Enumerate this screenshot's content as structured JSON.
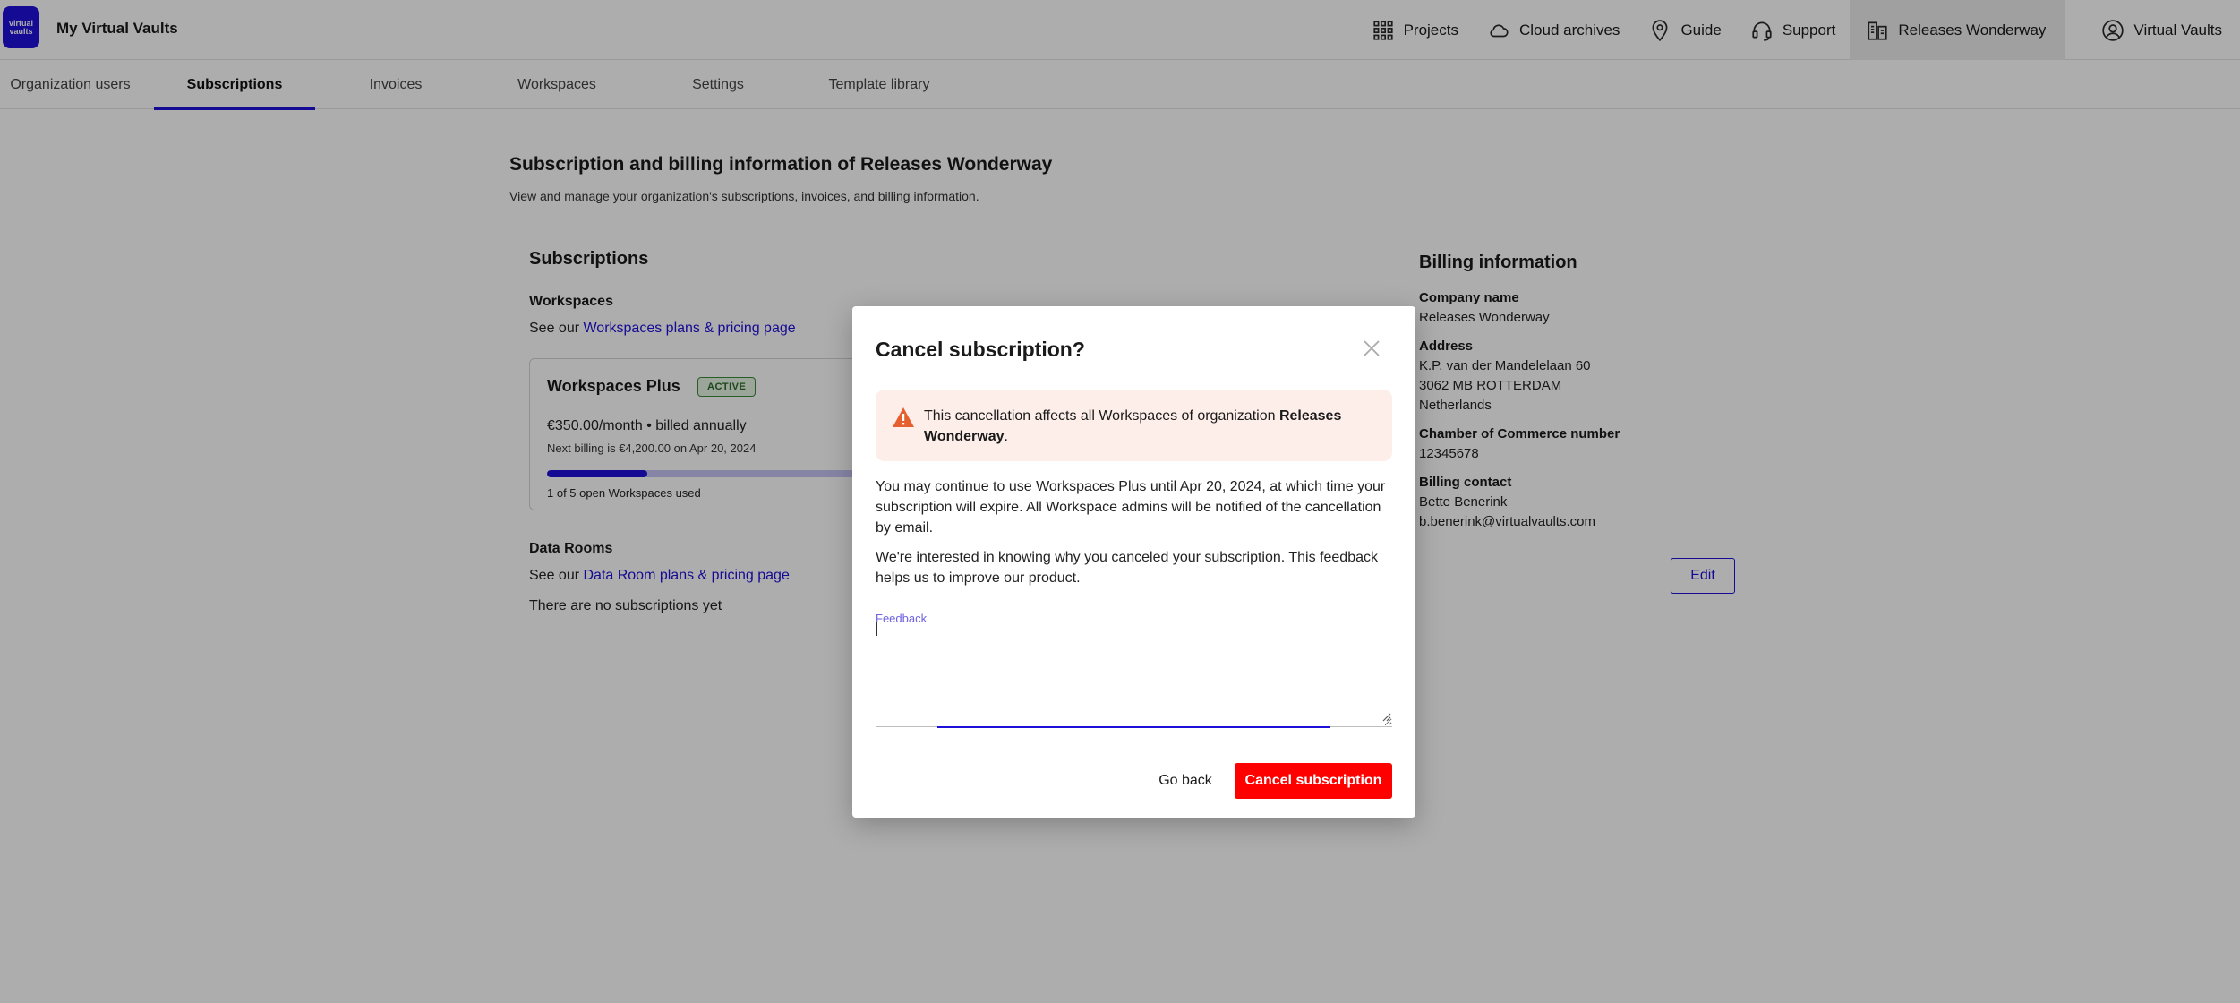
{
  "app": {
    "logo_line1": "virtual",
    "logo_line2": "vaults",
    "title": "My Virtual Vaults"
  },
  "topnav": {
    "projects": "Projects",
    "cloud_archives": "Cloud archives",
    "guide": "Guide",
    "support": "Support",
    "organization": "Releases Wonderway",
    "user": "Virtual Vaults"
  },
  "tabs": [
    {
      "label": "Organization users"
    },
    {
      "label": "Subscriptions",
      "active": true
    },
    {
      "label": "Invoices"
    },
    {
      "label": "Workspaces"
    },
    {
      "label": "Settings"
    },
    {
      "label": "Template library"
    }
  ],
  "page": {
    "title": "Subscription and billing information of Releases Wonderway",
    "subtitle": "View and manage your organization's subscriptions, invoices, and billing information."
  },
  "subscriptions": {
    "heading": "Subscriptions",
    "workspaces": {
      "title": "Workspaces",
      "see_prefix": "See our ",
      "link": "Workspaces plans & pricing page",
      "plan": {
        "name": "Workspaces Plus",
        "status": "ACTIVE",
        "price": "€350.00/month • billed annually",
        "next_billing": "Next billing is €4,200.00 on Apr 20, 2024",
        "usage_used": 1,
        "usage_total": 5,
        "usage_text": "1 of 5 open Workspaces used"
      }
    },
    "data_rooms": {
      "title": "Data Rooms",
      "see_prefix": "See our ",
      "link": "Data Room plans & pricing page",
      "empty": "There are no subscriptions yet"
    }
  },
  "billing": {
    "heading": "Billing information",
    "company_label": "Company name",
    "company": "Releases Wonderway",
    "address_label": "Address",
    "address_line1": "K.P. van der Mandelelaan 60",
    "address_line2": "3062 MB ROTTERDAM",
    "address_line3": "Netherlands",
    "coc_label": "Chamber of Commerce number",
    "coc": "12345678",
    "contact_label": "Billing contact",
    "contact_name": "Bette Benerink",
    "contact_email": "b.benerink@virtualvaults.com",
    "edit": "Edit"
  },
  "modal": {
    "title": "Cancel subscription?",
    "alert_prefix": "This cancellation affects all Workspaces of organization ",
    "alert_org": "Releases Wonderway",
    "alert_suffix": ".",
    "para1": "You may continue to use Workspaces Plus until Apr 20, 2024, at which time your subscription will expire. All Workspace admins will be notified of the cancellation by email.",
    "para2": "We're interested in knowing why you canceled your subscription. This feedback helps us to improve our product.",
    "feedback_label": "Feedback",
    "feedback_value": "",
    "go_back": "Go back",
    "confirm": "Cancel subscription"
  },
  "colors": {
    "brand": "#1e10d9",
    "danger": "#ff0000",
    "alert_bg": "#fdeeea",
    "warn": "#e5602e"
  }
}
